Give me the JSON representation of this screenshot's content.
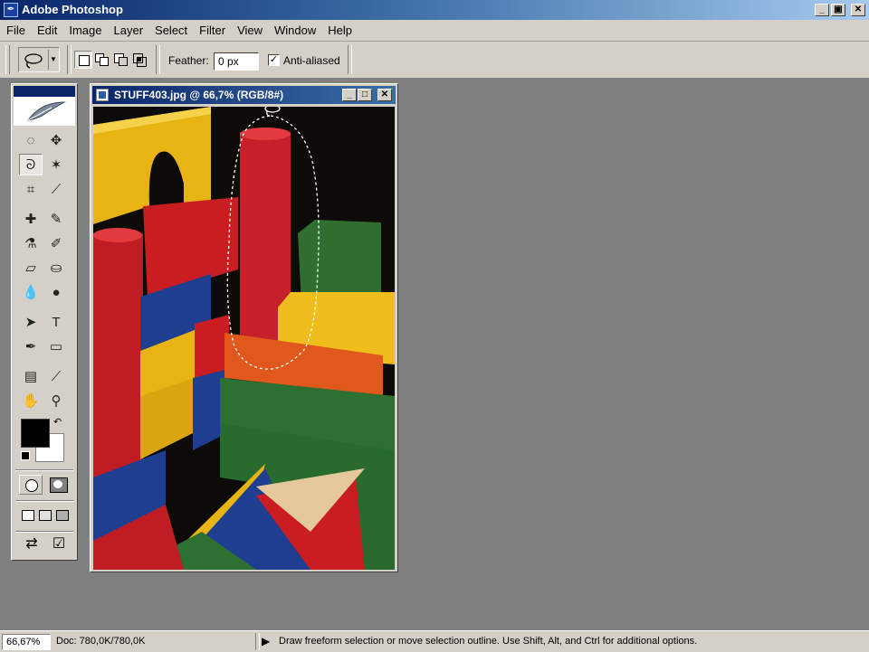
{
  "app": {
    "title": "Adobe Photoshop",
    "icon": "photoshop-feather-icon"
  },
  "window_controls": {
    "minimize": "_",
    "restore": "▣",
    "close": "✕"
  },
  "menu": {
    "items": [
      "File",
      "Edit",
      "Image",
      "Layer",
      "Select",
      "Filter",
      "View",
      "Window",
      "Help"
    ]
  },
  "options": {
    "tool_preset": "lasso-icon",
    "selection_modes": [
      "new-selection-icon",
      "add-to-selection-icon",
      "subtract-from-selection-icon",
      "intersect-selection-icon"
    ],
    "feather_label": "Feather:",
    "feather_value": "0 px",
    "antialias_label": "Anti-aliased",
    "antialias_checked": true
  },
  "toolbox": {
    "tools": [
      [
        "marquee-icon",
        "move-icon"
      ],
      [
        "lasso-icon",
        "magic-wand-icon"
      ],
      [
        "crop-icon",
        "slice-icon"
      ],
      [
        "healing-brush-icon",
        "brush-icon"
      ],
      [
        "clone-stamp-icon",
        "history-brush-icon"
      ],
      [
        "eraser-icon",
        "paint-bucket-icon"
      ],
      [
        "blur-icon",
        "dodge-icon"
      ],
      [
        "path-selection-icon",
        "type-icon"
      ],
      [
        "pen-icon",
        "rectangle-icon"
      ],
      [
        "notes-icon",
        "eyedropper-icon"
      ],
      [
        "hand-icon",
        "zoom-icon"
      ]
    ],
    "active_tool": "lasso-icon",
    "foreground_color": "#000000",
    "background_color": "#ffffff"
  },
  "document": {
    "title": "STUFF403.jpg @ 66,7% (RGB/8#)"
  },
  "status": {
    "zoom": "66,67%",
    "doc_info": "Doc: 780,0K/780,0K",
    "message": "Draw freeform selection or move selection outline.  Use Shift, Alt, and Ctrl for additional options."
  }
}
